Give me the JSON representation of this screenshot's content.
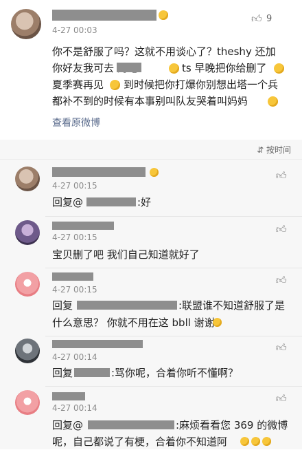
{
  "main_comment": {
    "time": "4-27 00:03",
    "like_count": "9",
    "text_line1": "你不是舒服了吗？这就不用谈心了？theshy 还加",
    "text_line2": "你好友我可去          的吧",
    "text_line2b": "ts 早晚把你给删了",
    "text_line3": "夏季赛再见",
    "text_line3b": "到时候把你打爆你别想出塔一个兵",
    "text_line4": "都补不到的时候有本事别叫队友哭着叫妈妈",
    "view_original": "查看原微博"
  },
  "sort_label": "按时间",
  "replies": [
    {
      "time": "4-27 00:15",
      "text": "回复@",
      "text_after": ":好"
    },
    {
      "time": "4-27 00:15",
      "text": "宝贝删了吧 我们自己知道就好了"
    },
    {
      "time": "4-27 00:15",
      "text": "回复",
      "text_after": ":联盟谁不知道舒服了是",
      "text2": "什么意思？ 你就不用在这 bbll 谢谢"
    },
    {
      "time": "4-27 00:14",
      "text": "回复",
      "text_after": ":骂你呢，合着你听不懂啊？"
    },
    {
      "time": "4-27 00:14",
      "text": "回复@",
      "text_after": ":麻烦看看您 369 的微博",
      "text2": "呢，自己都说了有梗，合着你不知道阿"
    }
  ]
}
